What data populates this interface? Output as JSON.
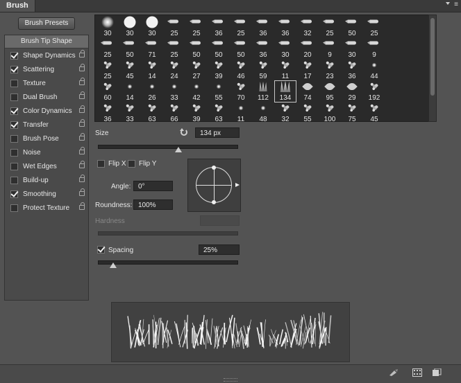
{
  "panel": {
    "tab_label": "Brush"
  },
  "left": {
    "presets_button": "Brush Presets",
    "tip_shape_label": "Brush Tip Shape",
    "options": [
      {
        "label": "Shape Dynamics",
        "checked": true
      },
      {
        "label": "Scattering",
        "checked": true
      },
      {
        "label": "Texture",
        "checked": false
      },
      {
        "label": "Dual Brush",
        "checked": false
      },
      {
        "label": "Color Dynamics",
        "checked": true
      },
      {
        "label": "Transfer",
        "checked": true
      },
      {
        "label": "Brush Pose",
        "checked": false
      },
      {
        "label": "Noise",
        "checked": false
      },
      {
        "label": "Wet Edges",
        "checked": false
      },
      {
        "label": "Build-up",
        "checked": false
      },
      {
        "label": "Smoothing",
        "checked": true
      },
      {
        "label": "Protect Texture",
        "checked": false
      }
    ]
  },
  "brush_tips": {
    "rows": [
      [
        {
          "size": "30",
          "kind": "soft"
        },
        {
          "size": "30",
          "kind": "hard-round"
        },
        {
          "size": "30",
          "kind": "hard-round"
        },
        {
          "size": "25",
          "kind": "pencil"
        },
        {
          "size": "25",
          "kind": "pencil"
        },
        {
          "size": "36",
          "kind": "pencil"
        },
        {
          "size": "25",
          "kind": "pencil"
        },
        {
          "size": "36",
          "kind": "pencil"
        },
        {
          "size": "36",
          "kind": "pencil"
        },
        {
          "size": "32",
          "kind": "pencil"
        },
        {
          "size": "25",
          "kind": "pencil"
        },
        {
          "size": "50",
          "kind": "pencil"
        },
        {
          "size": "25",
          "kind": "pencil"
        }
      ],
      [
        {
          "size": "25",
          "kind": "pencil"
        },
        {
          "size": "50",
          "kind": "pencil"
        },
        {
          "size": "71",
          "kind": "pencil"
        },
        {
          "size": "25",
          "kind": "pencil"
        },
        {
          "size": "50",
          "kind": "pencil"
        },
        {
          "size": "50",
          "kind": "pencil"
        },
        {
          "size": "50",
          "kind": "pencil"
        },
        {
          "size": "36",
          "kind": "pencil"
        },
        {
          "size": "30",
          "kind": "pencil"
        },
        {
          "size": "20",
          "kind": "pencil"
        },
        {
          "size": "9",
          "kind": "pencil"
        },
        {
          "size": "30",
          "kind": "pencil"
        },
        {
          "size": "9",
          "kind": "pencil"
        }
      ],
      [
        {
          "size": "25",
          "kind": "splat"
        },
        {
          "size": "45",
          "kind": "splat"
        },
        {
          "size": "14",
          "kind": "splat"
        },
        {
          "size": "24",
          "kind": "splat"
        },
        {
          "size": "27",
          "kind": "splat"
        },
        {
          "size": "39",
          "kind": "splat"
        },
        {
          "size": "46",
          "kind": "splat"
        },
        {
          "size": "59",
          "kind": "splat"
        },
        {
          "size": "11",
          "kind": "splat"
        },
        {
          "size": "17",
          "kind": "splat"
        },
        {
          "size": "23",
          "kind": "splat"
        },
        {
          "size": "36",
          "kind": "splat"
        },
        {
          "size": "44",
          "kind": "speck"
        }
      ],
      [
        {
          "size": "60",
          "kind": "splat"
        },
        {
          "size": "14",
          "kind": "speck"
        },
        {
          "size": "26",
          "kind": "speck"
        },
        {
          "size": "33",
          "kind": "speck"
        },
        {
          "size": "42",
          "kind": "speck"
        },
        {
          "size": "55",
          "kind": "speck"
        },
        {
          "size": "70",
          "kind": "splat"
        },
        {
          "size": "112",
          "kind": "stroke"
        },
        {
          "size": "134",
          "kind": "grass",
          "selected": true
        },
        {
          "size": "74",
          "kind": "leaf"
        },
        {
          "size": "95",
          "kind": "leaf"
        },
        {
          "size": "29",
          "kind": "leaf"
        },
        {
          "size": "192",
          "kind": "splat"
        }
      ],
      [
        {
          "size": "36",
          "kind": "splat"
        },
        {
          "size": "33",
          "kind": "splat"
        },
        {
          "size": "63",
          "kind": "splat"
        },
        {
          "size": "66",
          "kind": "splat"
        },
        {
          "size": "39",
          "kind": "splat"
        },
        {
          "size": "63",
          "kind": "splat"
        },
        {
          "size": "11",
          "kind": "speck"
        },
        {
          "size": "48",
          "kind": "speck"
        },
        {
          "size": "32",
          "kind": "splat"
        },
        {
          "size": "55",
          "kind": "splat"
        },
        {
          "size": "100",
          "kind": "splat"
        },
        {
          "size": "75",
          "kind": "splat"
        },
        {
          "size": "45",
          "kind": "splat"
        }
      ]
    ]
  },
  "controls": {
    "size_label": "Size",
    "size_value": "134 px",
    "size_slider_pct": 0.58,
    "flip_x_label": "Flip X",
    "flip_y_label": "Flip Y",
    "angle_label": "Angle:",
    "angle_value": "0°",
    "roundness_label": "Roundness:",
    "roundness_value": "100%",
    "hardness_label": "Hardness",
    "spacing_label": "Spacing",
    "spacing_checked": true,
    "spacing_value": "25%",
    "spacing_slider_pct": 0.11
  },
  "icons": {
    "panel_menu": "panel-menu-icon",
    "reset": "reset-icon",
    "bottom": [
      "toggle-live-tip-icon",
      "brush-grid-icon",
      "new-preset-icon"
    ]
  },
  "colors": {
    "panel_bg": "#535353",
    "grid_bg": "#2a2a2a",
    "field_bg": "#2e2e2e"
  }
}
